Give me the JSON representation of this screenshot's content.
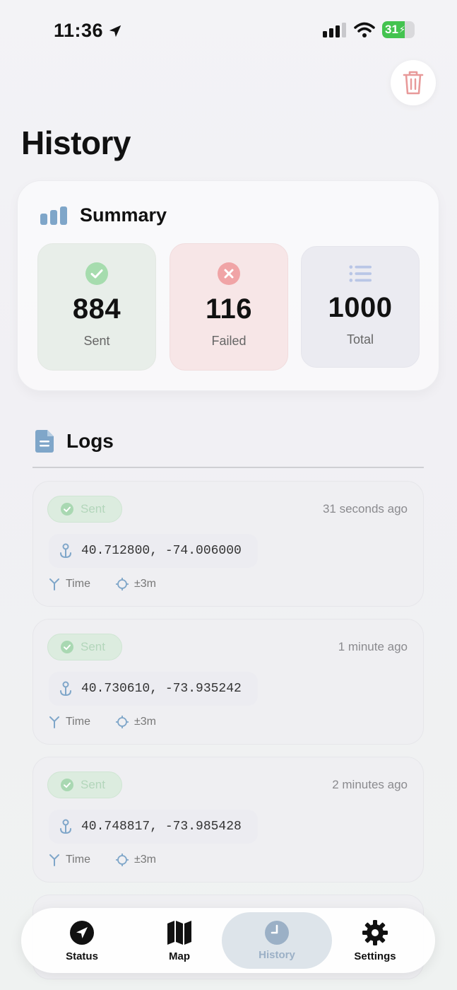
{
  "status_bar": {
    "time": "11:36",
    "battery": "31"
  },
  "page": {
    "title": "History"
  },
  "summary": {
    "title": "Summary",
    "stats": [
      {
        "value": "884",
        "label": "Sent"
      },
      {
        "value": "116",
        "label": "Failed"
      },
      {
        "value": "1000",
        "label": "Total"
      }
    ]
  },
  "logs": {
    "title": "Logs",
    "items": [
      {
        "status": "Sent",
        "ago": "31 seconds ago",
        "coords": "40.712800, -74.006000",
        "source": "Time",
        "accuracy": "±3m"
      },
      {
        "status": "Sent",
        "ago": "1 minute ago",
        "coords": "40.730610, -73.935242",
        "source": "Time",
        "accuracy": "±3m"
      },
      {
        "status": "Sent",
        "ago": "2 minutes ago",
        "coords": "40.748817, -73.985428",
        "source": "Time",
        "accuracy": "±3m"
      }
    ]
  },
  "tabs": [
    {
      "label": "Status",
      "icon": "location-arrow-icon"
    },
    {
      "label": "Map",
      "icon": "map-icon"
    },
    {
      "label": "History",
      "icon": "clock-icon",
      "active": true
    },
    {
      "label": "Settings",
      "icon": "gear-icon"
    }
  ],
  "colors": {
    "success": "#43c34f",
    "danger": "#e57373",
    "accent": "#7fa6c9"
  }
}
